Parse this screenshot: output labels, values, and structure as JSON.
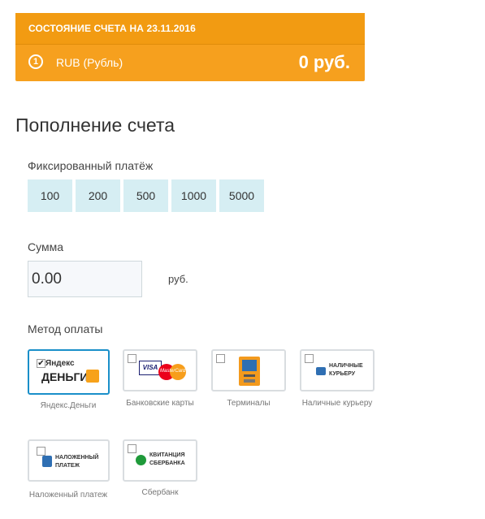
{
  "account": {
    "header": "СОСТОЯНИЕ СЧЕТА НА 23.11.2016",
    "currency_number": "1",
    "currency_label": "RUB (Рубль)",
    "balance": "0 руб."
  },
  "page_title": "Пополнение счета",
  "fixed_payment": {
    "label": "Фиксированный платёж",
    "amounts": [
      "100",
      "200",
      "500",
      "1000",
      "5000"
    ]
  },
  "sum": {
    "label": "Сумма",
    "value": "0.00",
    "currency_suffix": "руб."
  },
  "payment_method": {
    "label": "Метод оплаты",
    "methods": [
      {
        "name": "Яндекс.Деньги",
        "checked": true,
        "logo_lines": [
          "Яндекс",
          "ДЕНЬГИ"
        ]
      },
      {
        "name": "Банковские карты",
        "checked": false,
        "logo_lines": [
          "VISA",
          "MasterCard"
        ]
      },
      {
        "name": "Терминалы",
        "checked": false,
        "logo_lines": []
      },
      {
        "name": "Наличные курьеру",
        "checked": false,
        "logo_lines": [
          "НАЛИЧНЫЕ",
          "КУРЬЕРУ"
        ]
      },
      {
        "name": "Наложенный платеж",
        "checked": false,
        "logo_lines": [
          "НАЛОЖЕННЫЙ",
          "ПЛАТЕЖ"
        ]
      },
      {
        "name": "Сбербанк",
        "checked": false,
        "logo_lines": [
          "КВИТАНЦИЯ",
          "СБЕРБАНКА"
        ]
      }
    ]
  },
  "colors": {
    "accent_orange": "#f6a01e",
    "amount_button_bg": "#d6eef3",
    "selected_border": "#1a8fc9",
    "sberbank_green": "#1f9a3a"
  }
}
